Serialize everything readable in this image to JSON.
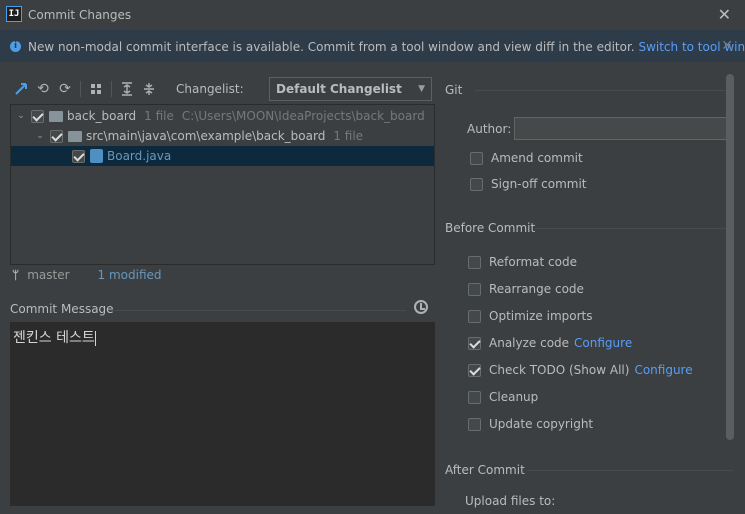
{
  "window": {
    "title": "Commit Changes",
    "logo_text": "IJ"
  },
  "banner": {
    "text": "New non-modal commit interface is available. Commit from a tool window and view diff in the editor.",
    "link": "Switch to tool window"
  },
  "toolbar": {
    "changelist_label": "Changelist:",
    "changelist_value": "Default Changelist"
  },
  "tree": {
    "root": {
      "name": "back_board",
      "count": "1 file",
      "path": "C:\\Users\\MOON\\IdeaProjects\\back_board"
    },
    "folder": {
      "name": "src\\main\\java\\com\\example\\back_board",
      "count": "1 file"
    },
    "file": {
      "name": "Board.java"
    }
  },
  "status": {
    "branch": "master",
    "modified": "1 modified"
  },
  "commit_message": {
    "label": "Commit Message",
    "value": "젠킨스 테스트"
  },
  "git": {
    "title": "Git",
    "author_label": "Author:",
    "author_value": "",
    "amend_label": "Amend commit",
    "signoff_label": "Sign-off commit"
  },
  "before_commit": {
    "title": "Before Commit",
    "reformat": "Reformat code",
    "rearrange": "Rearrange code",
    "optimize": "Optimize imports",
    "analyze": "Analyze code",
    "analyze_link": "Configure",
    "todo": "Check TODO (Show All)",
    "todo_link": "Configure",
    "cleanup": "Cleanup",
    "copyright": "Update copyright"
  },
  "after_commit": {
    "title": "After Commit",
    "upload_label": "Upload files to:"
  },
  "colors": {
    "accent_link": "#589df6",
    "selection": "#0d293e",
    "banner": "#2e3c4a"
  }
}
